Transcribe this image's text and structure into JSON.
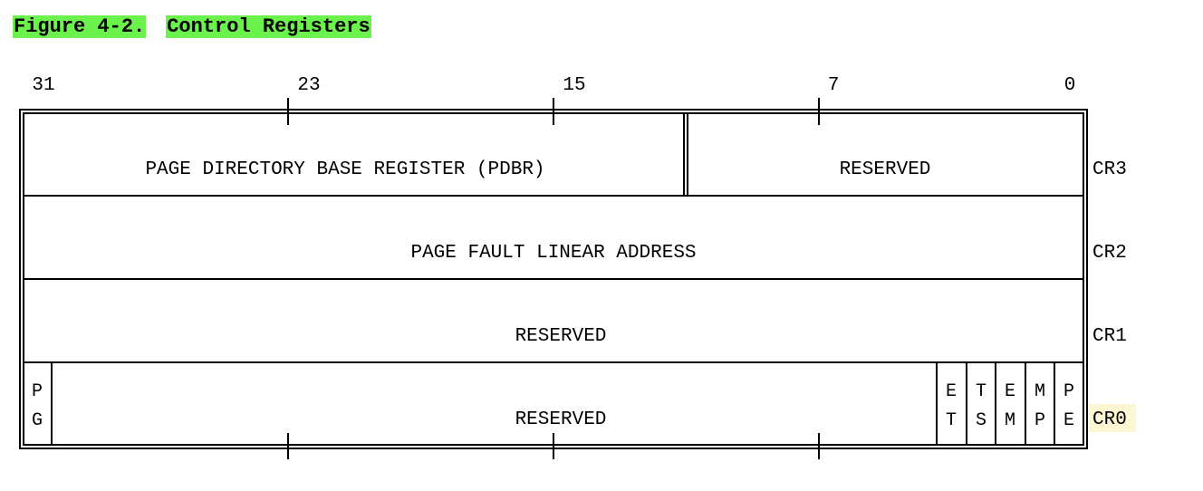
{
  "figure": {
    "number": "Figure 4-2.",
    "title": "Control Registers"
  },
  "bit_positions": [
    "31",
    "23",
    "15",
    "7",
    "0"
  ],
  "registers": [
    {
      "name": "CR3",
      "highlight": false,
      "fields": [
        {
          "label": "PAGE DIRECTORY BASE REGISTER (PDBR)"
        },
        {
          "label": "RESERVED"
        }
      ]
    },
    {
      "name": "CR2",
      "highlight": false,
      "fields": [
        {
          "label": "PAGE FAULT LINEAR ADDRESS"
        }
      ]
    },
    {
      "name": "CR1",
      "highlight": false,
      "fields": [
        {
          "label": "RESERVED"
        }
      ]
    },
    {
      "name": "CR0",
      "highlight": true,
      "fields": [
        {
          "label": "PG",
          "chars": [
            "P",
            "G"
          ]
        },
        {
          "label": "RESERVED"
        },
        {
          "label": "ET",
          "chars": [
            "E",
            "T"
          ]
        },
        {
          "label": "TS",
          "chars": [
            "T",
            "S"
          ]
        },
        {
          "label": "EM",
          "chars": [
            "E",
            "M"
          ]
        },
        {
          "label": "MP",
          "chars": [
            "M",
            "P"
          ]
        },
        {
          "label": "PE",
          "chars": [
            "P",
            "E"
          ]
        }
      ]
    }
  ],
  "colors": {
    "title_highlight": "#6cf24c",
    "cr0_label_highlight": "#fdf6d3",
    "line": "#000000"
  }
}
